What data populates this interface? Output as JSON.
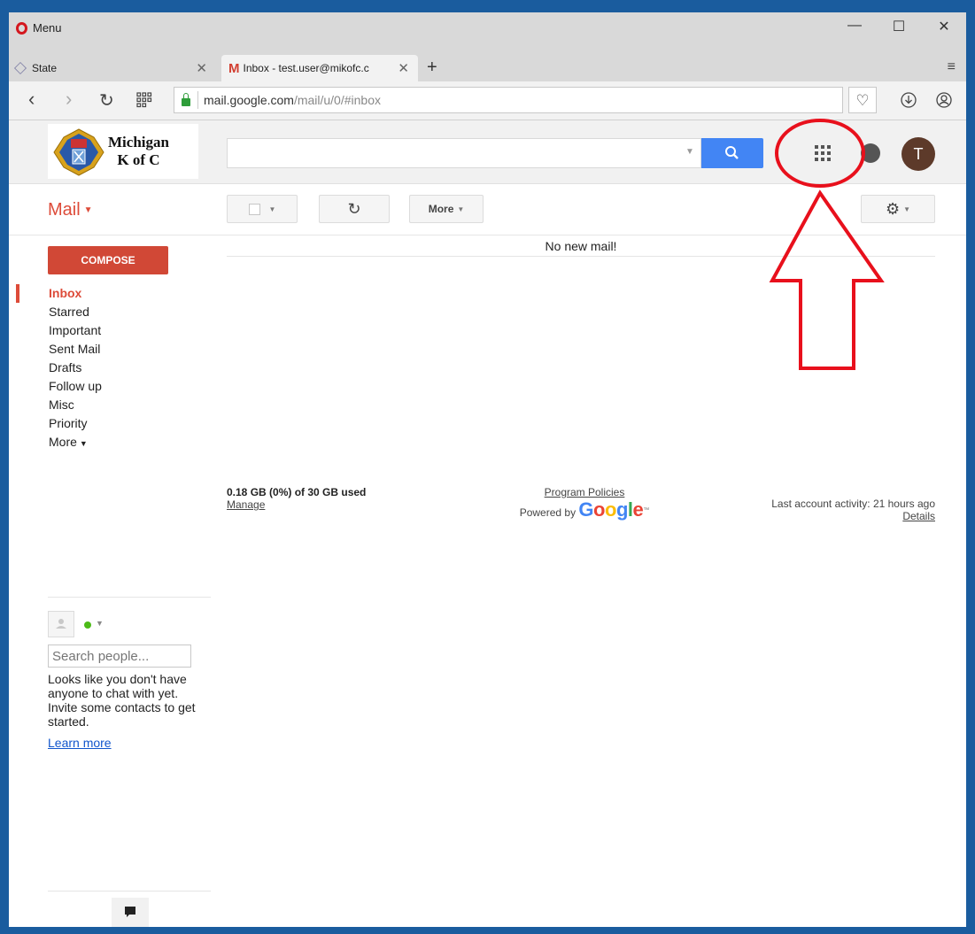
{
  "browser": {
    "menu_label": "Menu",
    "tabs": [
      {
        "title": "State"
      },
      {
        "title": "Inbox - test.user@mikofc.c"
      }
    ],
    "url_host": "mail.google.com",
    "url_path": "/mail/u/0/#inbox"
  },
  "logo": {
    "line1": "Michigan",
    "line2": "K of C",
    "emblem_text": "K of C"
  },
  "header": {
    "avatar_letter": "T"
  },
  "toolbar": {
    "mail_label": "Mail",
    "more_label": "More"
  },
  "sidebar": {
    "compose_label": "COMPOSE",
    "labels": [
      "Inbox",
      "Starred",
      "Important",
      "Sent Mail",
      "Drafts",
      "Follow up",
      "Misc",
      "Priority",
      "More"
    ],
    "people_search_placeholder": "Search people...",
    "chat_message": "Looks like you don't have anyone to chat with yet. Invite some contacts to get started.",
    "learn_more": "Learn more"
  },
  "main": {
    "empty_message": "No new mail!",
    "storage_usage": "0.18 GB (0%) of 30 GB used",
    "manage_link": "Manage",
    "program_policies": "Program Policies",
    "powered_by": "Powered by",
    "google_word": "Google",
    "last_activity": "Last account activity: 21 hours ago",
    "details_link": "Details"
  },
  "colors": {
    "annotation": "#e8101c",
    "brand_red": "#dd4b39",
    "search_blue": "#4285f4"
  }
}
